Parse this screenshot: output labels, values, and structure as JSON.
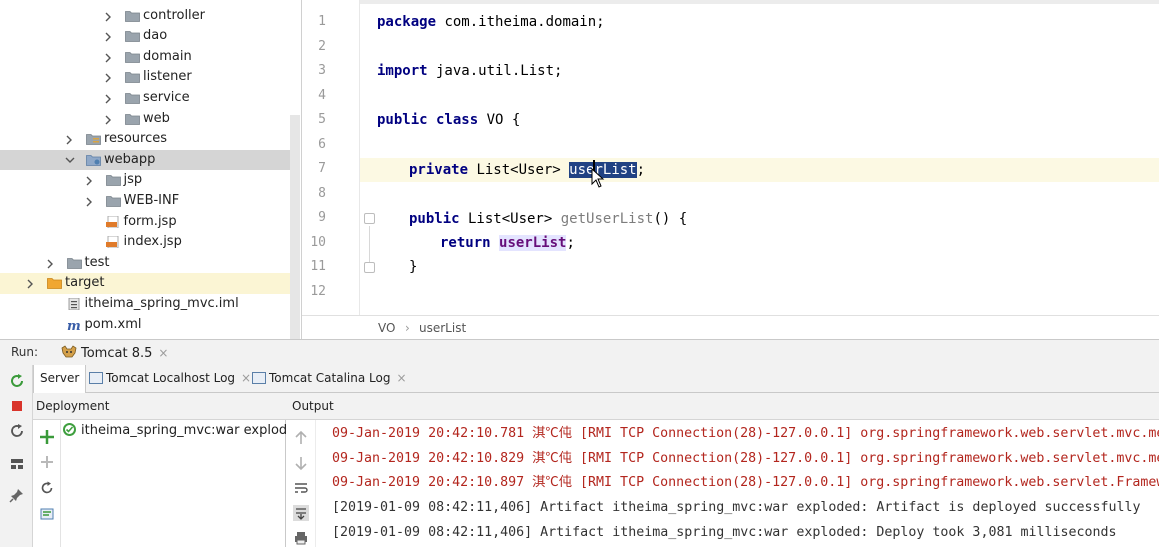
{
  "tree": {
    "items": [
      {
        "label": "controller",
        "indent": 4,
        "type": "folder",
        "arrow": true
      },
      {
        "label": "dao",
        "indent": 4,
        "type": "folder",
        "arrow": true
      },
      {
        "label": "domain",
        "indent": 4,
        "type": "folder",
        "arrow": true
      },
      {
        "label": "listener",
        "indent": 4,
        "type": "folder",
        "arrow": true
      },
      {
        "label": "service",
        "indent": 4,
        "type": "folder",
        "arrow": true
      },
      {
        "label": "web",
        "indent": 4,
        "type": "folder",
        "arrow": true
      },
      {
        "label": "resources",
        "indent": 2,
        "type": "res",
        "arrow": true
      },
      {
        "label": "webapp",
        "indent": 2,
        "type": "folder-blue",
        "arrow": "open",
        "selected": true
      },
      {
        "label": "jsp",
        "indent": 3,
        "type": "folder",
        "arrow": true
      },
      {
        "label": "WEB-INF",
        "indent": 3,
        "type": "folder",
        "arrow": true
      },
      {
        "label": "form.jsp",
        "indent": 3,
        "type": "jsp",
        "arrow": false
      },
      {
        "label": "index.jsp",
        "indent": 3,
        "type": "jsp",
        "arrow": false
      },
      {
        "label": "test",
        "indent": 1,
        "type": "folder",
        "arrow": true
      },
      {
        "label": "target",
        "indent": 0,
        "type": "folder-orange",
        "arrow": true,
        "target": true
      },
      {
        "label": "itheima_spring_mvc.iml",
        "indent": 1,
        "type": "iml",
        "arrow": false
      },
      {
        "label": "pom.xml",
        "indent": 1,
        "type": "maven",
        "arrow": false
      }
    ]
  },
  "editor": {
    "line_numbers": [
      "1",
      "2",
      "3",
      "4",
      "5",
      "6",
      "7",
      "8",
      "9",
      "10",
      "11",
      "12"
    ],
    "l1_kw": "package",
    "l1_rest": " com.itheima.domain;",
    "l3_kw": "import",
    "l3_rest": " java.util.List;",
    "l5_kw": "public class",
    "l5_rest": " VO {",
    "l7_kw": "private",
    "l7_type": " List<User> ",
    "l7_sel": "userList",
    "l7_end": ";",
    "l9_kw": "public",
    "l9_type": " List<User> ",
    "l9_method": "getUserList",
    "l9_end": "() {",
    "l10_kw": "return",
    "l10_field": "userList",
    "l10_end": ";",
    "l11": "}",
    "breadcrumb": [
      "VO",
      "userList"
    ],
    "breadcrumb_sep": "›"
  },
  "run": {
    "label": "Run:",
    "config_tab": "Tomcat 8.5",
    "close": "×",
    "subtabs": [
      "Server",
      "Tomcat Localhost Log",
      "Tomcat Catalina Log"
    ],
    "deployment_header": "Deployment",
    "output_header": "Output",
    "artifact": "itheima_spring_mvc:war exploded",
    "logs": [
      {
        "text": "09-Jan-2019 20:42:10.781 淇℃伅 [RMI TCP Connection(28)-127.0.0.1] org.springframework.web.servlet.mvc.me",
        "kind": "err"
      },
      {
        "text": "09-Jan-2019 20:42:10.829 淇℃伅 [RMI TCP Connection(28)-127.0.0.1] org.springframework.web.servlet.mvc.me",
        "kind": "err"
      },
      {
        "text": "09-Jan-2019 20:42:10.897 淇℃伅 [RMI TCP Connection(28)-127.0.0.1] org.springframework.web.servlet.Framew",
        "kind": "err"
      },
      {
        "text": "[2019-01-09 08:42:11,406] Artifact itheima_spring_mvc:war exploded: Artifact is deployed successfully",
        "kind": "info"
      },
      {
        "text": "[2019-01-09 08:42:11,406] Artifact itheima_spring_mvc:war exploded: Deploy took 3,081 milliseconds",
        "kind": "info"
      }
    ]
  }
}
